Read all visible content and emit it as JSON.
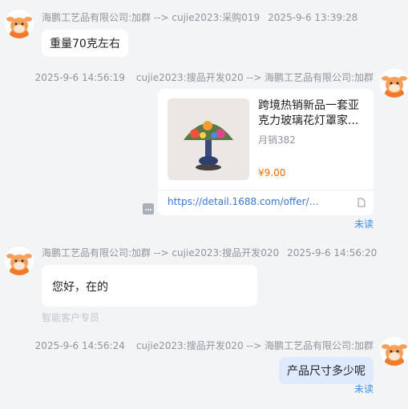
{
  "messages": [
    {
      "sender": "海鹏工艺品有限公司:加群 --> cujie2023:采购019",
      "time": "2025-9-6 13:39:28",
      "text": "重量70克左右"
    },
    {
      "time": "2025-9-6 14:56:19",
      "sender": "cujie2023:搜品开发020 --> 海鹏工艺品有限公司:加群",
      "card": {
        "title": "跨境热销新品一套亚克力玻璃花灯罩家...",
        "sales": "月销382",
        "price": "¥9.00",
        "link": "https://detail.1688.com/offer/85..."
      },
      "status": "未读"
    },
    {
      "sender": "海鹏工艺品有限公司:加群 --> cujie2023:搜品开发020",
      "time": "2025-9-6 14:56:20",
      "text": "您好，在的",
      "hint": "智能客户专员"
    },
    {
      "time": "2025-9-6 14:56:24",
      "sender": "cujie2023:搜品开发020 --> 海鹏工艺品有限公司:加群",
      "text": "产品尺寸多少呢",
      "status": "未读"
    }
  ],
  "icons": {
    "avatar": "cartoon-animal-avatar-icon",
    "copy": "document-icon",
    "small": "chat-small-icon"
  },
  "colors": {
    "background": "#f3f4f6",
    "self_bubble": "#dfeaff",
    "price": "#ff6a00",
    "link": "#3b75d6",
    "unread": "#3b8ee6"
  }
}
